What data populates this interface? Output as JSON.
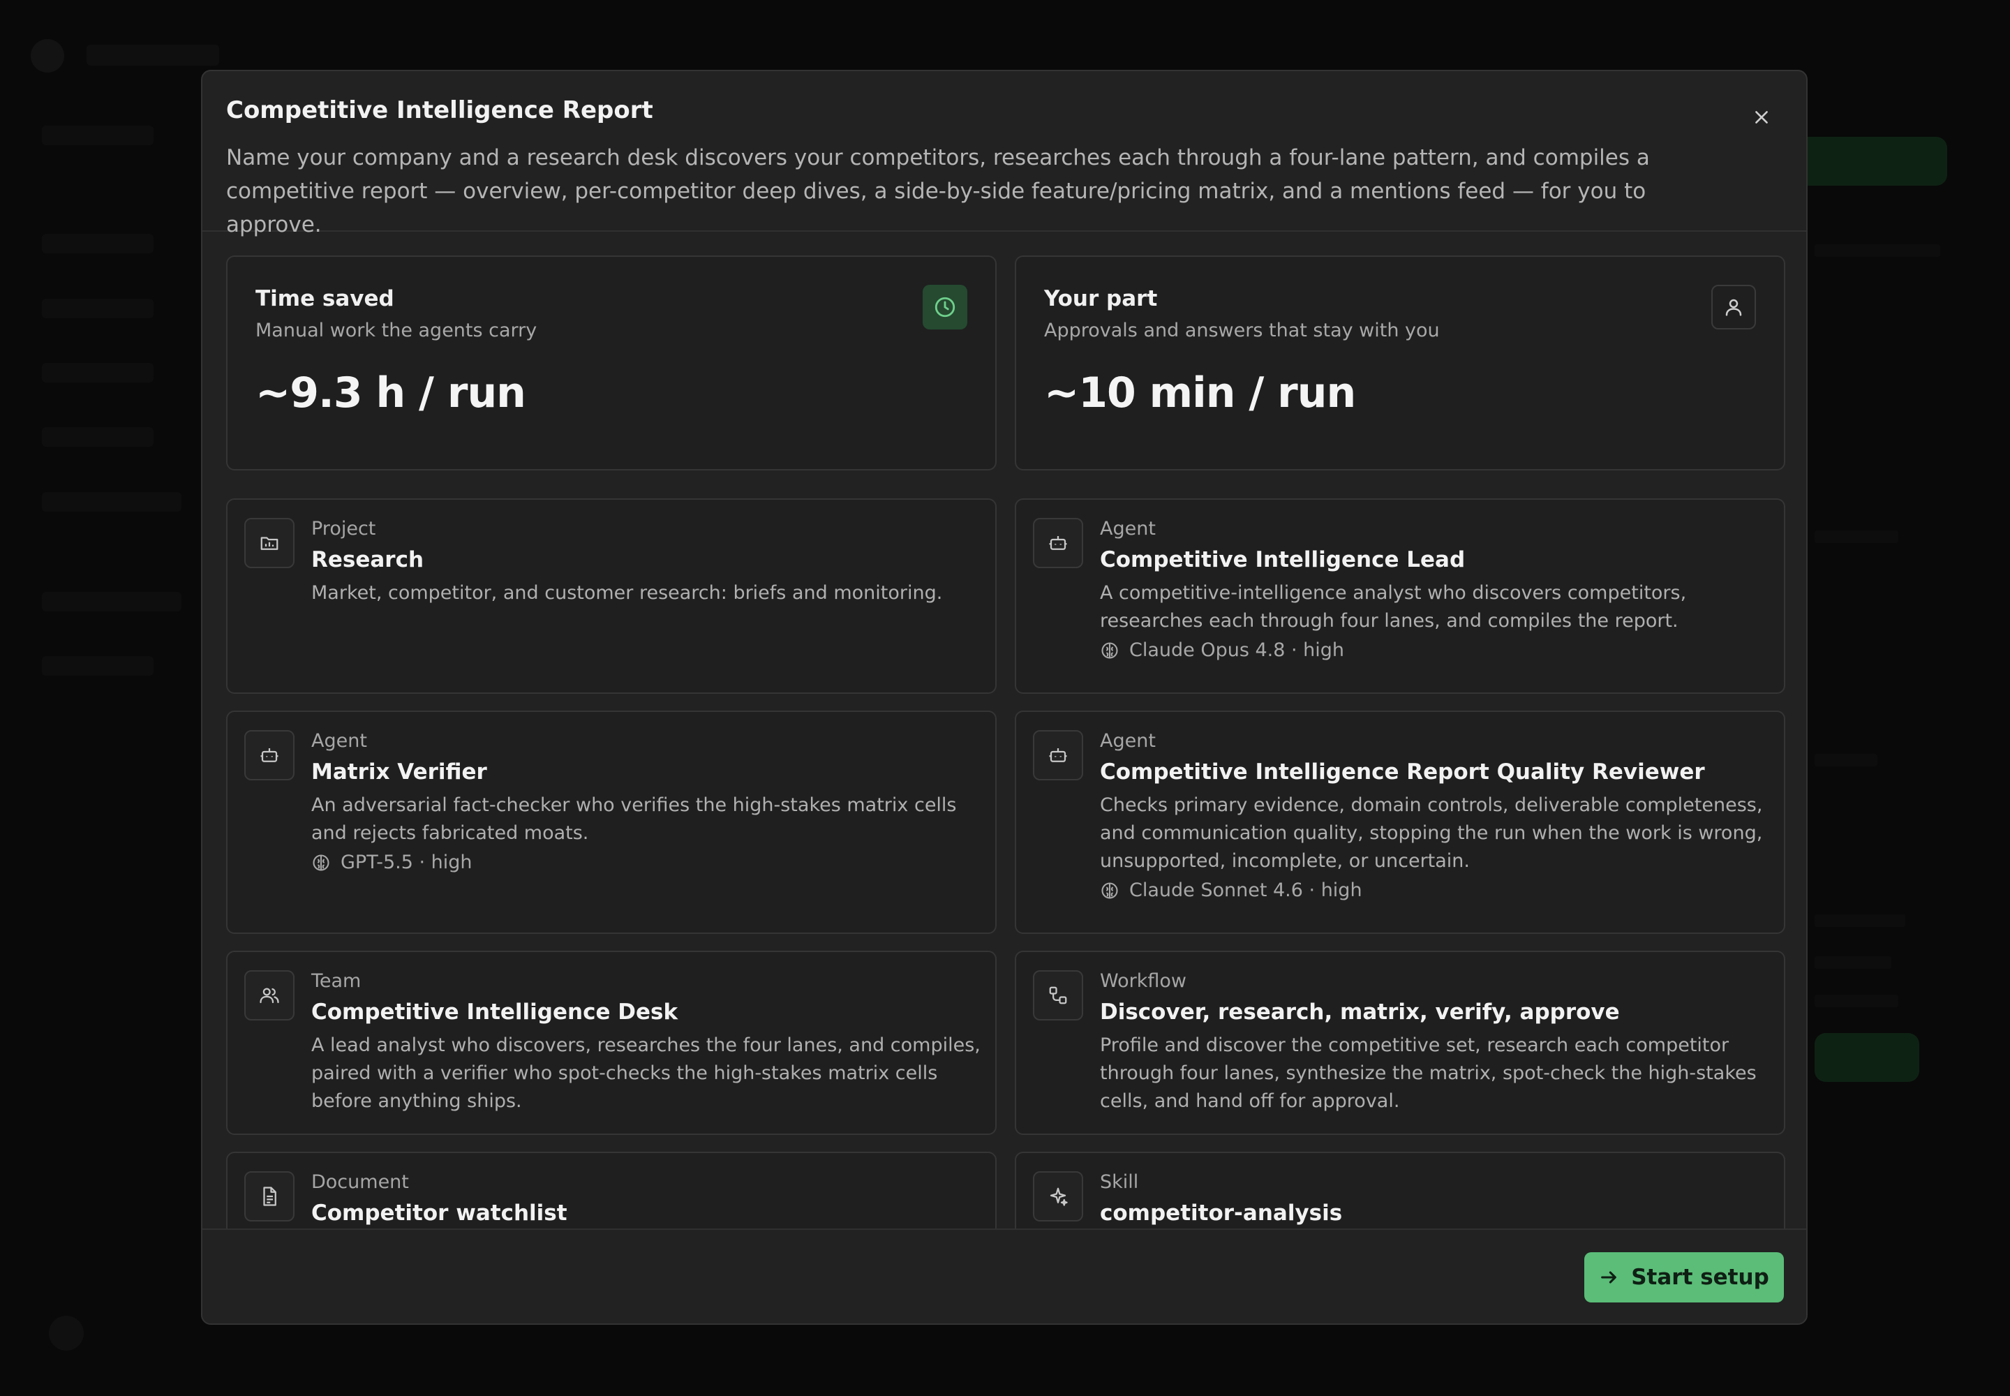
{
  "modal": {
    "title": "Competitive Intelligence Report",
    "description": "Name your company and a research desk discovers your competitors, researches each through a four-lane pattern, and compiles a competitive report — overview, per-competitor deep dives, a side-by-side feature/pricing matrix, and a mentions feed — for you to approve.",
    "close_icon": "close-icon"
  },
  "stats": {
    "time_saved": {
      "title": "Time saved",
      "subtitle": "Manual work the agents carry",
      "value": "~9.3 h / run",
      "icon": "clock-icon"
    },
    "your_part": {
      "title": "Your part",
      "subtitle": "Approvals and answers that stay with you",
      "value": "~10 min / run",
      "icon": "user-icon"
    }
  },
  "items": [
    {
      "kind": "Project",
      "name": "Research",
      "description": "Market, competitor, and customer research: briefs and monitoring.",
      "model": "",
      "icon": "folder-chart-icon"
    },
    {
      "kind": "Agent",
      "name": "Competitive Intelligence Lead",
      "description": "A competitive-intelligence analyst who discovers competitors, researches each through four lanes, and compiles the report.",
      "model": "Claude Opus 4.8 · high",
      "icon": "bot-icon"
    },
    {
      "kind": "Agent",
      "name": "Matrix Verifier",
      "description": "An adversarial fact-checker who verifies the high-stakes matrix cells and rejects fabricated moats.",
      "model": "GPT-5.5 · high",
      "icon": "bot-icon"
    },
    {
      "kind": "Agent",
      "name": "Competitive Intelligence Report Quality Reviewer",
      "description": "Checks primary evidence, domain controls, deliverable completeness, and communication quality, stopping the run when the work is wrong, unsupported, incomplete, or uncertain.",
      "model": "Claude Sonnet 4.6 · high",
      "icon": "bot-icon"
    },
    {
      "kind": "Team",
      "name": "Competitive Intelligence Desk",
      "description": "A lead analyst who discovers, researches the four lanes, and compiles, paired with a verifier who spot-checks the high-stakes matrix cells before anything ships.",
      "model": "",
      "icon": "users-icon"
    },
    {
      "kind": "Workflow",
      "name": "Discover, research, matrix, verify, approve",
      "description": "Profile and discover the competitive set, research each competitor through four lanes, synthesize the matrix, spot-check the high-stakes cells, and hand off for approval.",
      "model": "",
      "icon": "workflow-icon"
    },
    {
      "kind": "Document",
      "name": "Competitor watchlist",
      "description": "",
      "model": "",
      "icon": "document-icon"
    },
    {
      "kind": "Skill",
      "name": "competitor-analysis",
      "description": "",
      "model": "",
      "icon": "sparkle-icon"
    }
  ],
  "footer": {
    "start_label": "Start setup",
    "start_icon": "arrow-right-icon"
  },
  "colors": {
    "accent": "#5bbd78",
    "modal_bg": "#222222",
    "card_bg": "#1f1f1f"
  }
}
